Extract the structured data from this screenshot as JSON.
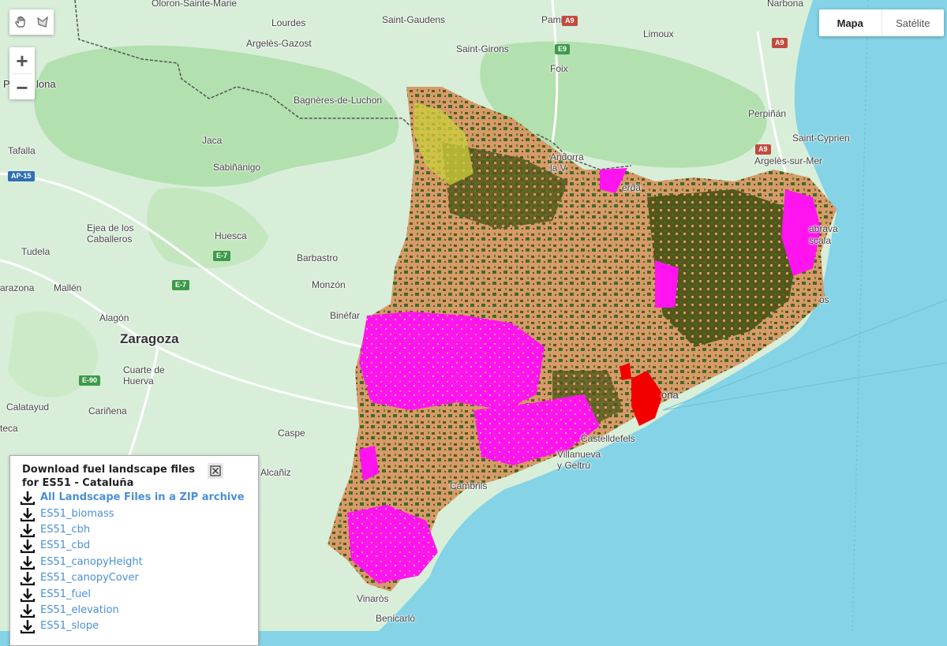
{
  "map_controls": {
    "zoom_in": "+",
    "zoom_out": "−",
    "map_type": {
      "map_label": "Mapa",
      "satellite_label": "Satélite"
    }
  },
  "places": {
    "oloron": "Oloron-Sainte-Marie",
    "saint_gaudens": "Saint-Gaudens",
    "pamiers": "Pamiers",
    "narbona": "Narbona",
    "lourdes": "Lourdes",
    "limoux": "Limoux",
    "argeles_gazost": "Argelès-Gazost",
    "saint_girons": "Saint-Girons",
    "foix": "Foix",
    "pamplona_part": "Pa",
    "pamplona_rest": "lona",
    "bagneres": "Bagnères-de-Luchon",
    "perpinan": "Perpiñán",
    "saint_cyprien": "Saint-Cyprien",
    "argeles_sur_mer": "Argelès-sur-Mer",
    "tafalla": "Tafalla",
    "jaca": "Jaca",
    "andorra": "Andorra la V",
    "sabinanigo": "Sabiñánigo",
    "puigcerda_part": "erdà",
    "ejea": "Ejea de los Caballeros",
    "huesca": "Huesca",
    "palafrugell_part": "abrava",
    "bisbal_part": "scala",
    "tudela": "Tudela",
    "barbastro": "Barbastro",
    "tarazona_part": "arazona",
    "mallen": "Mallén",
    "monzon": "Monzón",
    "alagon": "Alagón",
    "binefar": "Binéfar",
    "blanes_part": "os",
    "zaragoza": "Zaragoza",
    "cuarte": "Cuarte de Huerva",
    "barcelona_part": "ona",
    "calatayud": "Calatayud",
    "carinena": "Cariñena",
    "ateca_part": "teca",
    "caspe": "Caspe",
    "castelldefels": "Castelldefels",
    "vilanova": "Villanueva y Geltrú",
    "alcaniz": "Alcañiz",
    "cambrils": "Cambrils",
    "vinaros": "Vinaròs",
    "benicarlo": "Benicarló"
  },
  "roads": {
    "a9_top": "A9",
    "e9": "E9",
    "a9_mid": "A9",
    "ap15": "AP-15",
    "e7_a": "E-7",
    "e7_b": "E-7",
    "e90": "E-90"
  },
  "panel": {
    "title_line1": "Download fuel landscape files",
    "title_line2": "for ES51 - Cataluña",
    "items": [
      {
        "label": "All Landscape Files in a ZIP archive"
      },
      {
        "label": "ES51_biomass"
      },
      {
        "label": "ES51_cbh"
      },
      {
        "label": "ES51_cbd"
      },
      {
        "label": "ES51_canopyHeight"
      },
      {
        "label": "ES51_canopyCover"
      },
      {
        "label": "ES51_fuel"
      },
      {
        "label": "ES51_elevation"
      },
      {
        "label": "ES51_slope"
      }
    ]
  },
  "colors": {
    "sea": "#84d3e6",
    "land": "#d8eed9",
    "forest_light": "#a9dca4",
    "overlay_tan": "#d79a6a",
    "overlay_olive": "#5a5a12",
    "overlay_green": "#3f6b27",
    "overlay_magenta": "#ff14ef",
    "overlay_red": "#f20000",
    "overlay_yellow": "#cdcf3b",
    "link_blue": "#4a8fd8"
  }
}
